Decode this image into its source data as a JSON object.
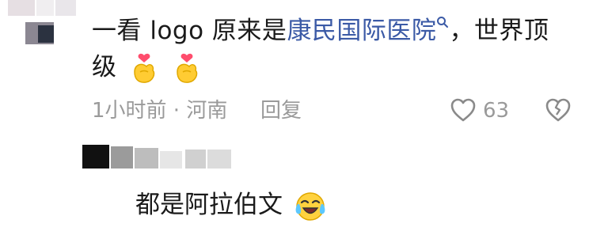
{
  "comment": {
    "prefix": "一看 logo 原来是",
    "link": "康民国际医院",
    "suffix": "，世界顶",
    "line2": "级",
    "emoji": "finger-heart-icon",
    "emoji_count": 2
  },
  "meta": {
    "time_location": "1小时前 · 河南",
    "reply": "回复",
    "like_count": "63"
  },
  "reply": {
    "text": "都是阿拉伯文",
    "emoji": "laughing-crying-icon"
  },
  "colors": {
    "link": "#3b5aa6",
    "meta": "#9a9a9a",
    "text": "#1a1a1a"
  }
}
